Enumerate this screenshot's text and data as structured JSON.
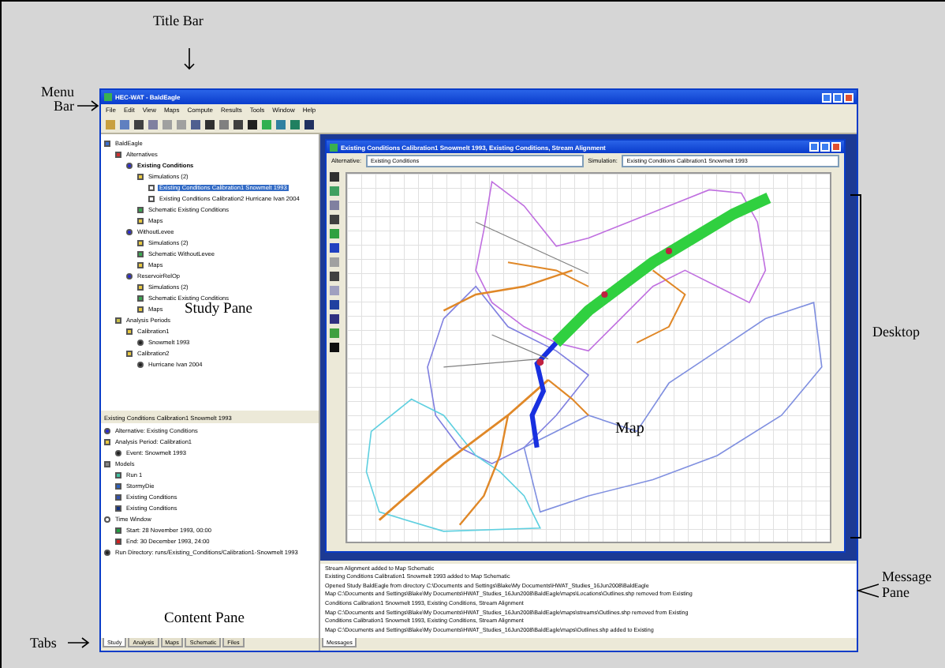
{
  "annotations": [
    {
      "kind": "title",
      "label": "Title Bar"
    },
    {
      "kind": "menu",
      "label": "Menu Bar"
    },
    {
      "kind": "study",
      "label": "Study Pane"
    },
    {
      "kind": "content",
      "label": "Content Pane"
    },
    {
      "kind": "tabs",
      "label": "Tabs"
    },
    {
      "kind": "desktop",
      "label": "Desktop"
    },
    {
      "kind": "map",
      "label": "Map"
    },
    {
      "kind": "message",
      "label": "Message Pane"
    }
  ],
  "window": {
    "title": "HEC-WAT - BaldEagle"
  },
  "menu": [
    "File",
    "Edit",
    "View",
    "Maps",
    "Compute",
    "Results",
    "Tools",
    "Window",
    "Help"
  ],
  "study_tree": [
    {
      "label": "BaldEagle",
      "kind": "study",
      "selected": false,
      "children": [
        {
          "label": "Alternatives",
          "kind": "flag",
          "selected": false,
          "children": [
            {
              "label": "Existing Conditions",
              "kind": "alternative",
              "active": true,
              "selected": false,
              "children": [
                {
                  "label": "Simulations (2)",
                  "kind": "folder",
                  "selected": false,
                  "children": [
                    {
                      "label": "Existing Conditions Calibration1 Snowmelt 1993",
                      "kind": "simulation",
                      "selected": true
                    },
                    {
                      "label": "Existing Conditions Calibration2 Hurricane Ivan 2004",
                      "kind": "simulation",
                      "selected": false
                    }
                  ]
                },
                {
                  "label": "Schematic Existing Conditions",
                  "kind": "schematic",
                  "selected": false
                },
                {
                  "label": "Maps",
                  "kind": "folder",
                  "selected": false
                }
              ]
            },
            {
              "label": "WithoutLevee",
              "kind": "alternative",
              "active": false,
              "selected": false,
              "children": [
                {
                  "label": "Simulations (2)",
                  "kind": "folder",
                  "selected": false
                },
                {
                  "label": "Schematic WithoutLevee",
                  "kind": "schematic",
                  "selected": false
                },
                {
                  "label": "Maps",
                  "kind": "folder",
                  "selected": false
                }
              ]
            },
            {
              "label": "ReservoirRelOp",
              "kind": "alternative",
              "active": false,
              "selected": false,
              "children": [
                {
                  "label": "Simulations (2)",
                  "kind": "folder",
                  "selected": false
                },
                {
                  "label": "Schematic Existing Conditions",
                  "kind": "schematic",
                  "selected": false
                },
                {
                  "label": "Maps",
                  "kind": "folder",
                  "selected": false
                }
              ]
            }
          ]
        },
        {
          "label": "Analysis Periods",
          "kind": "periods",
          "selected": false,
          "children": [
            {
              "label": "Calibration1",
              "kind": "folder",
              "selected": false,
              "children": [
                {
                  "label": "Snowmelt 1993",
                  "kind": "event",
                  "selected": false
                }
              ]
            },
            {
              "label": "Calibration2",
              "kind": "folder",
              "selected": false,
              "children": [
                {
                  "label": "Hurricane Ivan 2004",
                  "kind": "event",
                  "selected": false
                }
              ]
            }
          ]
        }
      ]
    }
  ],
  "content_pane": {
    "title": "Existing Conditions Calibration1 Snowmelt 1993",
    "items": [
      {
        "label": "Alternative: Existing Conditions",
        "kind": "alternative"
      },
      {
        "label": "Analysis Period: Calibration1",
        "kind": "folder",
        "children": [
          {
            "label": "Event: Snowmelt 1993",
            "kind": "event"
          }
        ]
      },
      {
        "label": "Models",
        "kind": "models",
        "children": [
          {
            "label": "Run 1",
            "kind": "model-a"
          },
          {
            "label": "StormyDie",
            "kind": "model-b"
          },
          {
            "label": "Existing Conditions",
            "kind": "model-c"
          },
          {
            "label": "Existing Conditions",
            "kind": "model-d"
          }
        ]
      },
      {
        "label": "Time Window",
        "kind": "time",
        "children": [
          {
            "label": "Start: 28 November 1993, 00:00",
            "kind": "start"
          },
          {
            "label": "End: 30 December 1993, 24:00",
            "kind": "end"
          }
        ]
      },
      {
        "label": "Run Directory: runs/Existing_Conditions/Calibration1-Snowmelt 1993",
        "kind": "event"
      }
    ]
  },
  "study_tabs": [
    {
      "label": "Study",
      "selected": true
    },
    {
      "label": "Analysis",
      "selected": false
    },
    {
      "label": "Maps",
      "selected": false
    },
    {
      "label": "Schematic",
      "selected": false
    },
    {
      "label": "Files",
      "selected": false
    }
  ],
  "map_window": {
    "title": "Existing Conditions Calibration1 Snowmelt 1993, Existing Conditions, Stream Alignment",
    "alternative_label": "Alternative:",
    "alternative": "Existing Conditions",
    "simulation_label": "Simulation:",
    "simulation": "Existing Conditions Calibration1 Snowmelt 1993"
  },
  "messages": [
    "Stream Alignment added to Map Schematic",
    "Existing Conditions Calibration1 Snowmelt 1993 added to Map Schematic",
    "Opened Study BaldEagle from directory C:\\Documents and Settings\\Blake\\My Documents\\HWAT_Studies_16Jun2008\\BaldEagle",
    "Map C:\\Documents and Settings\\Blake\\My Documents\\HWAT_Studies_16Jun2008\\BaldEagle\\maps\\Locations\\Outlines.shp removed from Existing",
    "Conditions Calibration1 Snowmelt 1993, Existing Conditions, Stream Alignment",
    "Map C:\\Documents and Settings\\Blake\\My Documents\\HWAT_Studies_16Jun2008\\BaldEagle\\maps\\streams\\Outlines.shp removed from Existing",
    "Conditions Calibration1 Snowmelt 1993, Existing Conditions, Stream Alignment",
    "Map C:\\Documents and Settings\\Blake\\My Documents\\HWAT_Studies_16Jun2008\\BaldEagle\\maps\\Outlines.shp added to Existing"
  ],
  "message_tabs": [
    {
      "label": "Messages",
      "selected": true
    }
  ]
}
